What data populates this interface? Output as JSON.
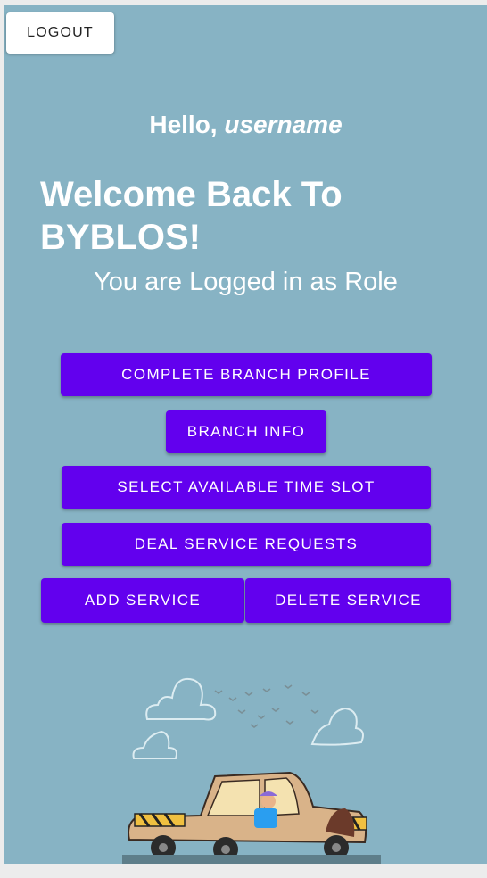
{
  "header": {
    "logout_label": "LOGOUT"
  },
  "greeting": {
    "hello": "Hello, ",
    "username": "username"
  },
  "welcome": {
    "title": "Welcome Back To BYBLOS!",
    "role_text": "You are Logged in as Role"
  },
  "actions": {
    "complete_profile": "COMPLETE BRANCH PROFILE",
    "branch_info": "BRANCH INFO",
    "select_time_slot": "SELECT AVAILABLE TIME SLOT",
    "deal_requests": "DEAL SERVICE REQUESTS",
    "add_service": "ADD SERVICE",
    "delete_service": "DELETE SERVICE"
  },
  "colors": {
    "background": "#87b3c4",
    "primary": "#6200ee",
    "text": "#ffffff"
  },
  "illustration": {
    "icon": "car-driver-illustration"
  }
}
